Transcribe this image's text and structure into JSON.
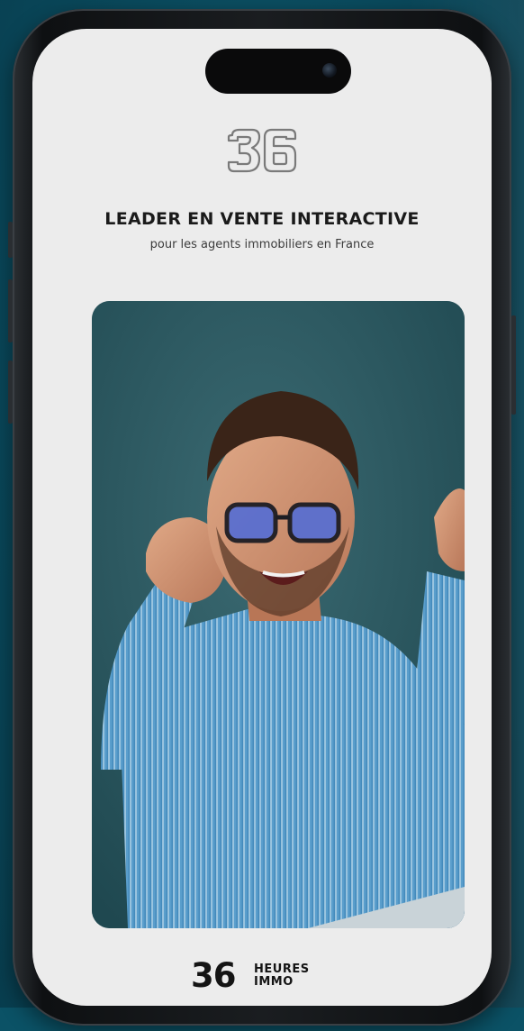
{
  "headline": "LEADER EN VENTE INTERACTIVE",
  "subline": "pour les agents immobiliers en France",
  "brand": {
    "number": "36",
    "word_top": "HEURES",
    "word_bottom": "IMMO"
  },
  "icons": {
    "logo": "36-logo-outline-icon",
    "camera": "front-camera-icon"
  },
  "colors": {
    "background": "#0a4b5e",
    "screen": "#ececec",
    "text": "#1a1a1a"
  }
}
